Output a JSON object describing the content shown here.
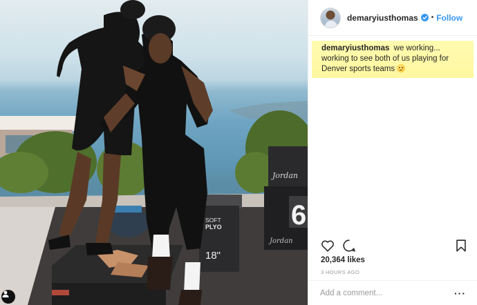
{
  "post": {
    "username": "demaryiusthomas",
    "follow_label": "Follow",
    "separator": "•",
    "caption_text": "we working... working to see both of us playing for Denver sports teams",
    "likes": "20,364 likes",
    "timestamp": "3 HOURS AGO"
  },
  "comment_box": {
    "placeholder": "Add a comment...",
    "more_label": "···"
  },
  "photo": {
    "box_brand_1": "Jordan",
    "box_brand_2": "Jordan",
    "box_number": "6",
    "plyo_label_1": "SOFT",
    "plyo_label_2": "PLYO",
    "plyo_size": "18\""
  },
  "colors": {
    "follow_blue": "#3897f0",
    "caption_highlight": "#fff7a0",
    "verified_blue": "#3897f0"
  },
  "icons": [
    "user-tag-icon",
    "verified-badge-icon",
    "heart-icon",
    "comment-icon",
    "bookmark-icon",
    "more-options-icon",
    "smile-emoji-icon"
  ]
}
